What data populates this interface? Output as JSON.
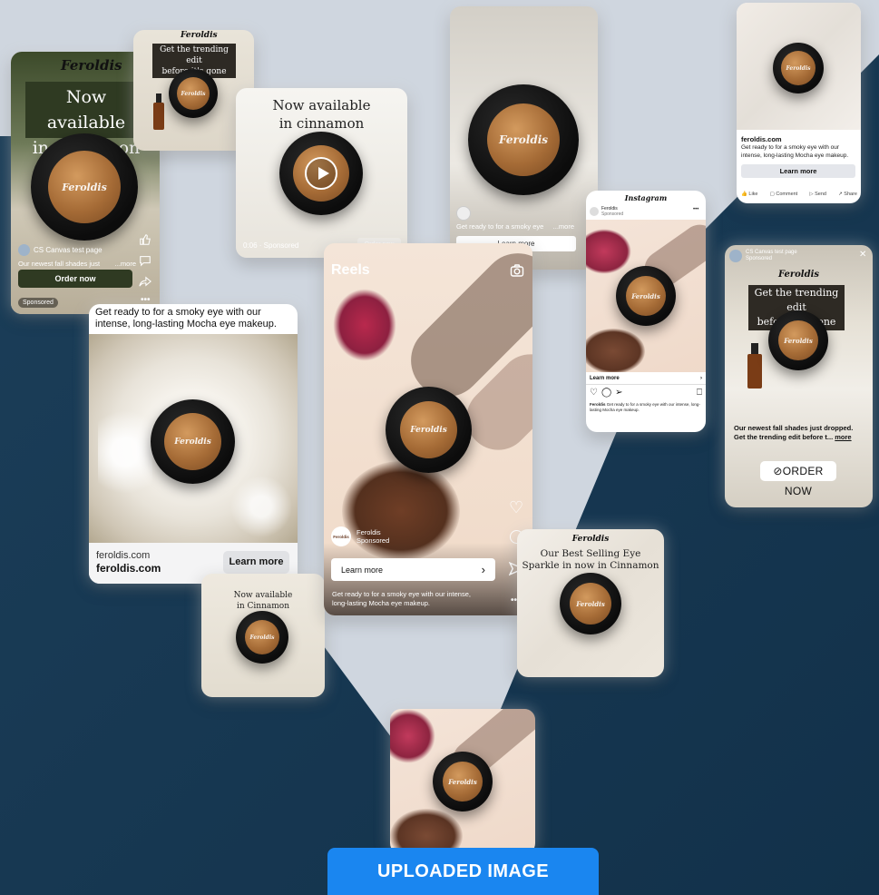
{
  "brand": "Feroldis",
  "cards": {
    "fb_video": {
      "headline_line1": "Now available",
      "headline_line2": "in cinnamon",
      "page_name": "CS Canvas test page",
      "caption": "Our newest fall shades just",
      "more": "...more",
      "cta": "Order now",
      "sponsored": "Sponsored"
    },
    "small_trending": {
      "line1": "Get the trending edit",
      "line2": "before it's gone"
    },
    "video_player": {
      "line1": "Now available",
      "line2": "in cinnamon",
      "meta": "0:06 · Sponsored",
      "cta": "Order now"
    },
    "story_top": {
      "caption": "Get ready to for a smoky eye",
      "more": "...more",
      "cta": "Learn more"
    },
    "fb_feed": {
      "domain": "feroldis.com",
      "text": "Get ready to for a smoky eye with our intense, long-lasting Mocha eye makeup.",
      "cta": "Learn more",
      "actions": [
        "Like",
        "Comment",
        "Send",
        "Share"
      ]
    },
    "instagram": {
      "app": "Instagram",
      "account": "Feroldis",
      "sponsored": "Sponsored",
      "cta": "Learn more",
      "caption_user": "Feroldis",
      "caption": "Get ready to for a smoky eye with our intense, long-lasting Mocha eye makeup."
    },
    "fb_story": {
      "page_name": "CS Canvas test page",
      "sponsored": "Sponsored",
      "line1": "Get the trending edit",
      "line2": "before it's gone",
      "body1": "Our newest fall shades just dropped.",
      "body2": "Get the trending edit before t...",
      "more": "more",
      "cta": "ORDER NOW"
    },
    "feed_white": {
      "text": "Get ready to for a smoky eye with our intense, long-lasting Mocha eye makeup.",
      "domain_small": "feroldis.com",
      "domain_bold": "feroldis.com",
      "cta": "Learn more"
    },
    "reels": {
      "title": "Reels",
      "account": "Feroldis",
      "sponsored": "Sponsored",
      "avatar_text": "Feroldis",
      "cta": "Learn more",
      "caption": "Get ready to for a smoky eye with our intense, long-lasting Mocha eye makeup."
    },
    "small_cinnamon": {
      "line1": "Now available",
      "line2": "in Cinnamon"
    },
    "best_selling": {
      "line1": "Our Best Selling Eye",
      "line2": "Sparkle in now in Cinnamon"
    }
  },
  "uploaded_button": "UPLOADED IMAGE",
  "colors": {
    "background_dark": "#16354d",
    "background_light": "#cfd6df",
    "button_blue": "#1a86f0",
    "order_green": "#2f3a22"
  },
  "icons": [
    "like-icon",
    "comment-icon",
    "share-icon",
    "play-icon",
    "camera-icon",
    "heart-icon",
    "send-icon",
    "bookmark-icon",
    "link-icon",
    "close-icon",
    "more-icon"
  ]
}
